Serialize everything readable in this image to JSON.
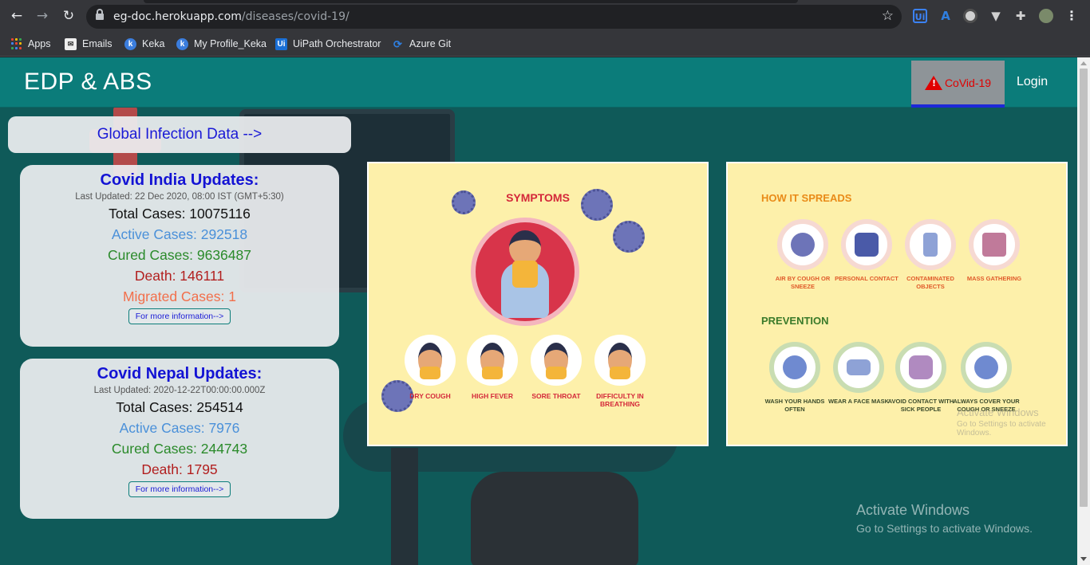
{
  "browser": {
    "url_host": "eg-doc.herokuapp.com",
    "url_path": "/diseases/covid-19/",
    "bookmarks": [
      {
        "label": "Apps",
        "icon": "apps-grid-icon"
      },
      {
        "label": "Emails",
        "icon": "mail-icon"
      },
      {
        "label": "Keka",
        "icon": "keka-icon"
      },
      {
        "label": "My Profile_Keka",
        "icon": "keka-icon"
      },
      {
        "label": "UiPath Orchestrator",
        "icon": "uipath-icon"
      },
      {
        "label": "Azure Git",
        "icon": "azure-devops-icon"
      }
    ]
  },
  "navbar": {
    "brand": "EDP & ABS",
    "covid_label": "CoVid-19",
    "login_label": "Login",
    "accent_color": "#0b7c7a"
  },
  "global": {
    "label": "Global Infection Data -->"
  },
  "india": {
    "title": "Covid India Updates:",
    "updated": "Last Updated: 22 Dec 2020, 08:00 IST (GMT+5:30)",
    "total": "Total Cases: 10075116",
    "active": "Active Cases: 292518",
    "cured": "Cured Cases: 9636487",
    "death": "Death: 146111",
    "migrated": "Migrated Cases: 1",
    "more": "For more information-->"
  },
  "nepal": {
    "title": "Covid Nepal Updates:",
    "updated": "Last Updated: 2020-12-22T00:00:00.000Z",
    "total": "Total Cases: 254514",
    "active": "Active Cases: 7976",
    "cured": "Cured Cases: 244743",
    "death": "Death: 1795",
    "more": "For more information-->"
  },
  "symptoms": {
    "title": "SYMPTOMS",
    "items": [
      "DRY COUGH",
      "HIGH FEVER",
      "SORE THROAT",
      "DIFFICULTY IN BREATHING"
    ]
  },
  "spread": {
    "title": "HOW IT SPREADS",
    "items": [
      "AIR BY COUGH OR SNEEZE",
      "PERSONAL CONTACT",
      "CONTAMINATED OBJECTS",
      "MASS GATHERING"
    ],
    "prevention_title": "PREVENTION",
    "prevention_items": [
      "WASH YOUR HANDS OFTEN",
      "WEAR A FACE MASK",
      "AVOID CONTACT WITH SICK PEOPLE",
      "ALWAYS COVER YOUR COUGH OR SNEEZE"
    ]
  },
  "watermark": {
    "line1": "Activate Windows",
    "line2": "Go to Settings to activate Windows."
  }
}
